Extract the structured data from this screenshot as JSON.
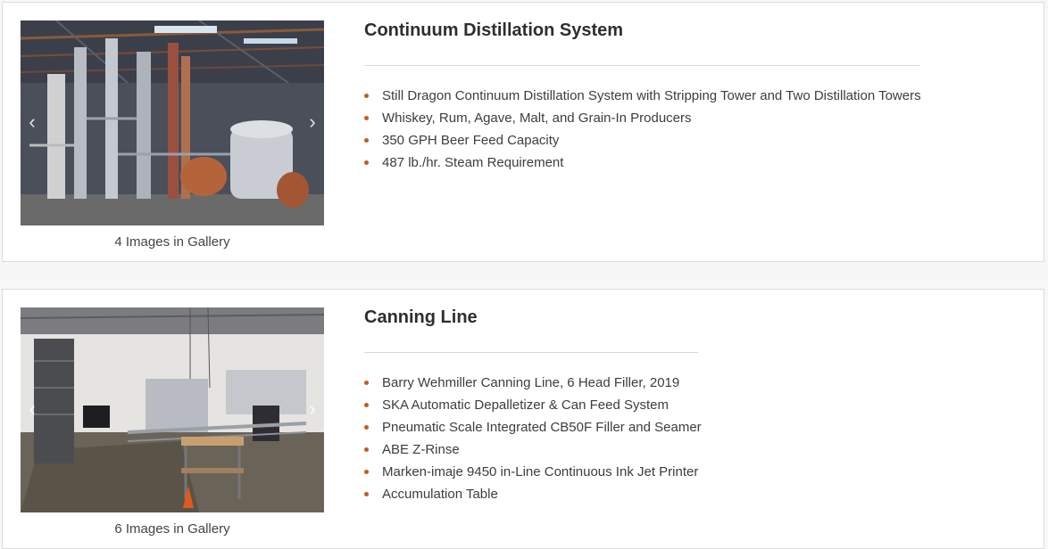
{
  "accent_color": "#c55a1e",
  "listings": [
    {
      "title": "Continuum Distillation System",
      "gallery_caption": "4 Images in Gallery",
      "features": [
        "Still Dragon Continuum Distillation System with Stripping Tower and Two Distillation Towers",
        "Whiskey, Rum, Agave, Malt, and Grain-In Producers",
        "350 GPH Beer Feed Capacity",
        "487 lb./hr. Steam Requirement"
      ]
    },
    {
      "title": "Canning Line",
      "gallery_caption": "6 Images in Gallery",
      "features": [
        "Barry Wehmiller Canning Line, 6 Head Filler, 2019",
        "SKA Automatic Depalletizer & Can Feed System",
        "Pneumatic Scale Integrated CB50F Filler and Seamer",
        "ABE Z-Rinse",
        "Marken-imaje 9450 in-Line Continuous Ink Jet Printer",
        "Accumulation Table"
      ]
    }
  ]
}
